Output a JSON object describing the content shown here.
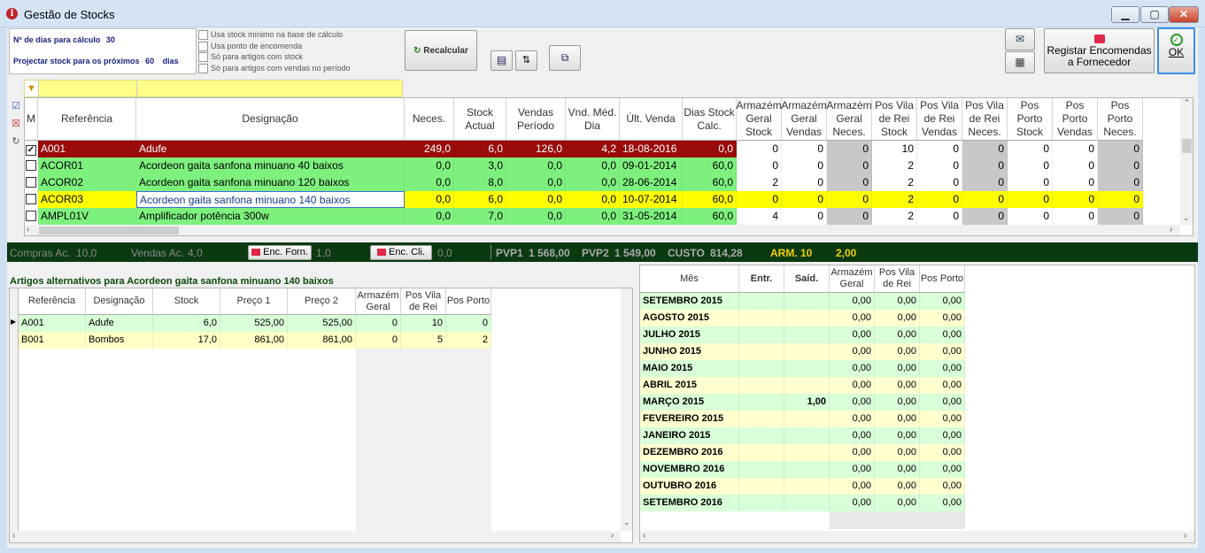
{
  "window": {
    "title": "Gestão de Stocks",
    "minimize": "▁",
    "maximize": "▢",
    "close": "✕"
  },
  "params": {
    "dias_label": "Nº de dias para cálculo",
    "dias_value": "30",
    "projectar_label": "Projectar stock para os próximos",
    "projectar_value": "60",
    "projectar_unit": "dias",
    "options": [
      "Usa stock mínimo na base de cálculo",
      "Usa ponto de encomenda",
      "Só para artigos com stock",
      "Só para artigos com vendas no período"
    ]
  },
  "toolbar": {
    "recalcular": "Recalcular",
    "registar": "Registar Encomendas a Fornecedor",
    "ok": "OK"
  },
  "grid": {
    "columns": [
      "M",
      "Referência",
      "Designação",
      "Neces.",
      "Stock Actual",
      "Vendas Período",
      "Vnd. Méd. Dia",
      "Últ. Venda",
      "Dias Stock Calc.",
      "Armazém Geral Stock",
      "Armazém Geral Vendas",
      "Armazém Geral Neces.",
      "Pos Vila de Rei Stock",
      "Pos Vila de Rei Vendas",
      "Pos Vila de Rei Neces.",
      "Pos Porto Stock",
      "Pos Porto Vendas",
      "Pos Porto Neces."
    ],
    "rows": [
      {
        "checked": true,
        "ref": "A001",
        "des": "Adufe",
        "neces": "249,0",
        "stock": "6,0",
        "vendas": "126,0",
        "vmd": "4,2",
        "ult": "18-08-2016",
        "dias": "0,0",
        "ag_s": "0",
        "ag_v": "0",
        "ag_n": "0",
        "vr_s": "10",
        "vr_v": "0",
        "vr_n": "0",
        "po_s": "0",
        "po_v": "0",
        "po_n": "0"
      },
      {
        "checked": false,
        "ref": "ACOR01",
        "des": "Acordeon gaita sanfona minuano 40 baixos",
        "neces": "0,0",
        "stock": "3,0",
        "vendas": "0,0",
        "vmd": "0,0",
        "ult": "09-01-2014",
        "dias": "60,0",
        "ag_s": "0",
        "ag_v": "0",
        "ag_n": "0",
        "vr_s": "2",
        "vr_v": "0",
        "vr_n": "0",
        "po_s": "0",
        "po_v": "0",
        "po_n": "0"
      },
      {
        "checked": false,
        "ref": "ACOR02",
        "des": "Acordeon gaita sanfona minuano 120 baixos",
        "neces": "0,0",
        "stock": "8,0",
        "vendas": "0,0",
        "vmd": "0,0",
        "ult": "28-06-2014",
        "dias": "60,0",
        "ag_s": "2",
        "ag_v": "0",
        "ag_n": "0",
        "vr_s": "2",
        "vr_v": "0",
        "vr_n": "0",
        "po_s": "0",
        "po_v": "0",
        "po_n": "0"
      },
      {
        "checked": false,
        "ref": "ACOR03",
        "des": "Acordeon gaita sanfona minuano 140 baixos",
        "neces": "0,0",
        "stock": "6,0",
        "vendas": "0,0",
        "vmd": "0,0",
        "ult": "10-07-2014",
        "dias": "60,0",
        "ag_s": "0",
        "ag_v": "0",
        "ag_n": "0",
        "vr_s": "2",
        "vr_v": "0",
        "vr_n": "0",
        "po_s": "0",
        "po_v": "0",
        "po_n": "0"
      },
      {
        "checked": false,
        "ref": "AMPL01V",
        "des": "Amplificador potência 300w",
        "neces": "0,0",
        "stock": "7,0",
        "vendas": "0,0",
        "vmd": "0,0",
        "ult": "31-05-2014",
        "dias": "60,0",
        "ag_s": "4",
        "ag_v": "0",
        "ag_n": "0",
        "vr_s": "2",
        "vr_v": "0",
        "vr_n": "0",
        "po_s": "0",
        "po_v": "0",
        "po_n": "0"
      }
    ]
  },
  "status": {
    "compras_label": "Compras Ac.",
    "compras": "10,0",
    "vendas_label": "Vendas Ac.",
    "vendas": "4,0",
    "enc_forn": "Enc. Forn.",
    "enc_forn_val": "1,0",
    "enc_cli": "Enc. Cli.",
    "enc_cli_val": "0,0",
    "pvp1_label": "PVP1",
    "pvp1": "1 568,00",
    "pvp2_label": "PVP2",
    "pvp2": "1 549,00",
    "custo_label": "CUSTO",
    "custo": "814,28",
    "arm_label": "ARM. 10",
    "arm": "2,00"
  },
  "alt": {
    "title": "Artigos alternativos para Acordeon gaita sanfona minuano 140 baixos",
    "columns": [
      "Referência",
      "Designação",
      "Stock",
      "Preço 1",
      "Preço 2",
      "Armazém Geral",
      "Pos Vila de Rei",
      "Pos Porto"
    ],
    "rows": [
      {
        "ref": "A001",
        "des": "Adufe",
        "stock": "6,0",
        "p1": "525,00",
        "p2": "525,00",
        "ag": "0",
        "vr": "10",
        "po": "0"
      },
      {
        "ref": "B001",
        "des": "Bombos",
        "stock": "17,0",
        "p1": "861,00",
        "p2": "861,00",
        "ag": "0",
        "vr": "5",
        "po": "2"
      }
    ]
  },
  "months": {
    "columns": [
      "Mês",
      "Entr.",
      "Saíd.",
      "Armazém Geral",
      "Pos Vila de Rei",
      "Pos Porto"
    ],
    "rows": [
      {
        "m": "SETEMBRO 2015",
        "e": "",
        "s": "",
        "a": "0,00",
        "v": "0,00",
        "p": "0,00"
      },
      {
        "m": "AGOSTO 2015",
        "e": "",
        "s": "",
        "a": "0,00",
        "v": "0,00",
        "p": "0,00"
      },
      {
        "m": "JULHO 2015",
        "e": "",
        "s": "",
        "a": "0,00",
        "v": "0,00",
        "p": "0,00"
      },
      {
        "m": "JUNHO 2015",
        "e": "",
        "s": "",
        "a": "0,00",
        "v": "0,00",
        "p": "0,00"
      },
      {
        "m": "MAIO 2015",
        "e": "",
        "s": "",
        "a": "0,00",
        "v": "0,00",
        "p": "0,00"
      },
      {
        "m": "ABRIL 2015",
        "e": "",
        "s": "",
        "a": "0,00",
        "v": "0,00",
        "p": "0,00"
      },
      {
        "m": "MARÇO 2015",
        "e": "",
        "s": "1,00",
        "a": "0,00",
        "v": "0,00",
        "p": "0,00"
      },
      {
        "m": "FEVEREIRO 2015",
        "e": "",
        "s": "",
        "a": "0,00",
        "v": "0,00",
        "p": "0,00"
      },
      {
        "m": "JANEIRO 2015",
        "e": "",
        "s": "",
        "a": "0,00",
        "v": "0,00",
        "p": "0,00"
      },
      {
        "m": "DEZEMBRO 2016",
        "e": "",
        "s": "",
        "a": "0,00",
        "v": "0,00",
        "p": "0,00"
      },
      {
        "m": "NOVEMBRO 2016",
        "e": "",
        "s": "",
        "a": "0,00",
        "v": "0,00",
        "p": "0,00"
      },
      {
        "m": "OUTUBRO 2016",
        "e": "",
        "s": "",
        "a": "0,00",
        "v": "0,00",
        "p": "0,00"
      },
      {
        "m": "SETEMBRO 2016",
        "e": "",
        "s": "",
        "a": "0,00",
        "v": "0,00",
        "p": "0,00"
      }
    ]
  },
  "colors": {
    "red_row": "#9a0c0c",
    "green_row": "#7ef07e",
    "yellow_row": "#ffff00",
    "alt_yellow": "#ffffc6",
    "status_bg": "#0b3a11"
  }
}
